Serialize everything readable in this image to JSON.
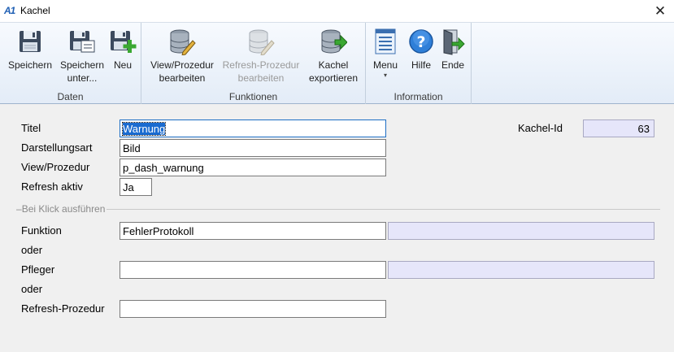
{
  "window": {
    "title": "Kachel",
    "logo": "A1",
    "close_glyph": "✕"
  },
  "ribbon": {
    "groups": [
      {
        "label": "Daten",
        "buttons": [
          {
            "line1": "Speichern",
            "line2": "",
            "icon": "floppy-disk-icon"
          },
          {
            "line1": "Speichern",
            "line2": "unter...",
            "icon": "save-as-icon"
          },
          {
            "line1": "Neu",
            "line2": "",
            "icon": "new-record-icon"
          }
        ]
      },
      {
        "label": "Funktionen",
        "buttons": [
          {
            "line1": "View/Prozedur",
            "line2": "bearbeiten",
            "icon": "database-edit-icon"
          },
          {
            "line1": "Refresh-Prozedur",
            "line2": "bearbeiten",
            "icon": "database-refresh-icon",
            "disabled": true
          },
          {
            "line1": "Kachel",
            "line2": "exportieren",
            "icon": "database-export-icon"
          }
        ]
      },
      {
        "label": "Information",
        "buttons": [
          {
            "line1": "Menu",
            "line2": "▾",
            "icon": "menu-icon"
          },
          {
            "line1": "Hilfe",
            "line2": "",
            "icon": "help-icon"
          },
          {
            "line1": "Ende",
            "line2": "",
            "icon": "exit-door-icon"
          }
        ]
      }
    ]
  },
  "form": {
    "titel_label": "Titel",
    "titel_value": "Warnung",
    "darstellungsart_label": "Darstellungsart",
    "darstellungsart_value": "Bild",
    "view_label": "View/Prozedur",
    "view_value": "p_dash_warnung",
    "refresh_label": "Refresh aktiv",
    "refresh_value": "Ja",
    "kachel_id_label": "Kachel-Id",
    "kachel_id_value": "63",
    "section_label": "Bei Klick ausführen",
    "funktion_label": "Funktion",
    "funktion_value": "FehlerProtokoll",
    "funktion_extra": "",
    "oder1": "oder",
    "pfleger_label": "Pfleger",
    "pfleger_value": "",
    "pfleger_extra": "",
    "oder2": "oder",
    "refresh_proc_label": "Refresh-Prozedur",
    "refresh_proc_value": ""
  },
  "colors": {
    "accent": "#1a6bd0",
    "readonly_bg": "#e6e6fa",
    "ribbon_top": "#f7fafe",
    "ribbon_bottom": "#e3ecf7"
  }
}
